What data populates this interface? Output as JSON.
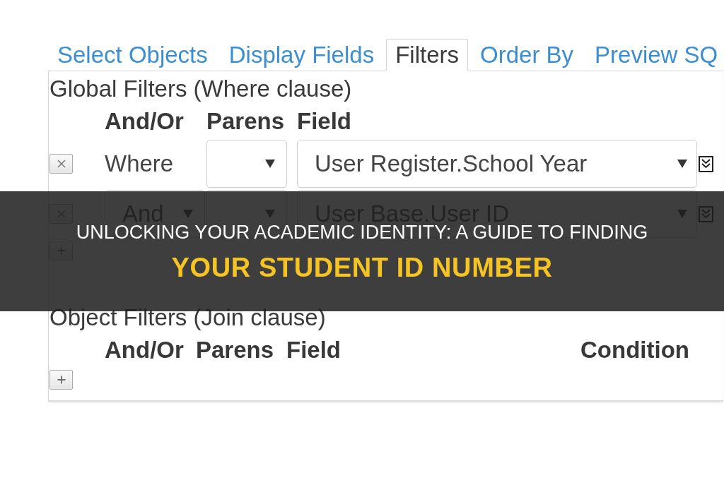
{
  "tabs": [
    {
      "label": "Select Objects",
      "selected": false
    },
    {
      "label": "Display Fields",
      "selected": false
    },
    {
      "label": "Filters",
      "selected": true
    },
    {
      "label": "Order By",
      "selected": false
    },
    {
      "label": "Preview SQ",
      "selected": false
    }
  ],
  "global_filters": {
    "title": "Global Filters (Where clause)",
    "columns": [
      "And/Or",
      "Parens",
      "Field"
    ],
    "rows": [
      {
        "kind": "text",
        "and_or": "Where",
        "field": "User Register.School Year"
      },
      {
        "kind": "dropdown",
        "and_or": "And",
        "field": "User Base.User ID"
      }
    ]
  },
  "object_filters": {
    "title": "Object Filters (Join clause)",
    "columns": [
      "And/Or",
      "Parens",
      "Field",
      "Condition"
    ]
  },
  "banner": {
    "title": "UNLOCKING YOUR ACADEMIC IDENTITY: A GUIDE TO FINDING",
    "highlight": "YOUR STUDENT ID NUMBER"
  }
}
